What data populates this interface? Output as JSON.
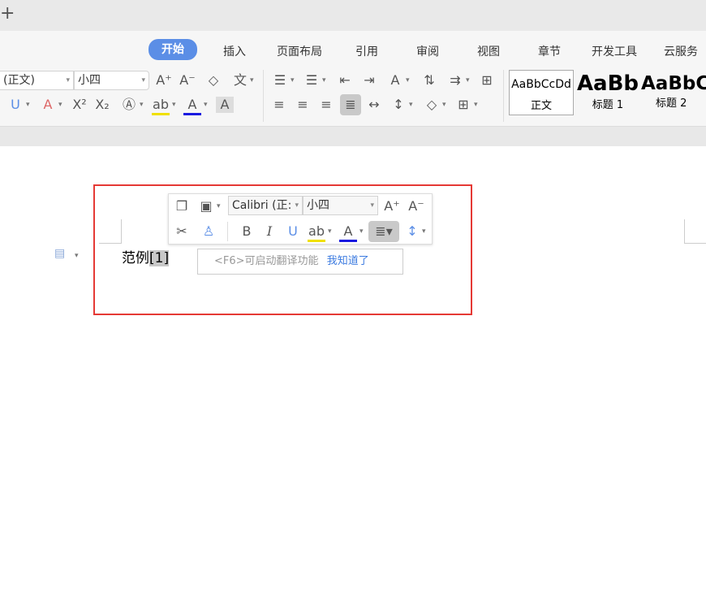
{
  "titlebar": {
    "new_tab": "+"
  },
  "tabs": [
    "开始",
    "插入",
    "页面布局",
    "引用",
    "审阅",
    "视图",
    "章节",
    "开发工具",
    "云服务"
  ],
  "ribbon": {
    "font_name": "(正文)",
    "font_size": "小四",
    "styles": [
      {
        "preview": "AaBbCcDd",
        "label": "正文"
      },
      {
        "preview": "AaBb",
        "label": "标题 1"
      },
      {
        "preview": "AaBbC",
        "label": "标题 2"
      }
    ]
  },
  "document": {
    "text": "范例",
    "highlighted": "[1]"
  },
  "mini_toolbar": {
    "font_name": "Calibri (正:",
    "font_size": "小四"
  },
  "tooltip": {
    "hint": "<F6>可启动翻译功能",
    "dismiss": "我知道了"
  },
  "colors": {
    "accent": "#5b8ee6",
    "red_box": "#e53935",
    "highlight": "#f0e000",
    "font_color": "#1a1ae0"
  }
}
